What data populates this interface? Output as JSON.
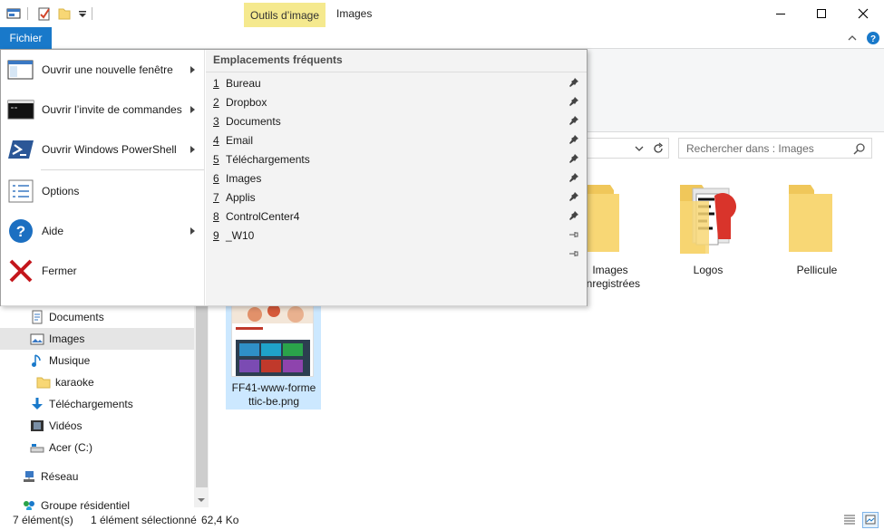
{
  "window": {
    "context_tab": "Outils d’image",
    "title": "Images"
  },
  "ribbon": {
    "file_tab": "Fichier"
  },
  "file_menu": {
    "items": [
      {
        "label": "Ouvrir une nouvelle fenêtre",
        "icon": "new-window-icon",
        "submenu": true
      },
      {
        "label": "Ouvrir l’invite de commandes",
        "icon": "command-prompt-icon",
        "submenu": true
      },
      {
        "label": "Ouvrir Windows PowerShell",
        "icon": "powershell-icon",
        "submenu": true
      },
      {
        "label": "Options",
        "icon": "options-icon",
        "submenu": false
      },
      {
        "label": "Aide",
        "icon": "help-icon",
        "submenu": true
      },
      {
        "label": "Fermer",
        "icon": "close-red-x-icon",
        "submenu": false
      }
    ],
    "frequent_title": "Emplacements fréquents",
    "frequent": [
      {
        "num": "1",
        "label": "Bureau",
        "pinned": true
      },
      {
        "num": "2",
        "label": "Dropbox",
        "pinned": true
      },
      {
        "num": "3",
        "label": "Documents",
        "pinned": true
      },
      {
        "num": "4",
        "label": "Email",
        "pinned": true
      },
      {
        "num": "5",
        "label": "Téléchargements",
        "pinned": true
      },
      {
        "num": "6",
        "label": "Images",
        "pinned": true
      },
      {
        "num": "7",
        "label": "Applis",
        "pinned": true
      },
      {
        "num": "8",
        "label": "ControlCenter4",
        "pinned": true
      },
      {
        "num": "9",
        "label": "_W10",
        "pinned": false
      },
      {
        "num": "",
        "label": "",
        "pinned": false
      }
    ]
  },
  "search": {
    "placeholder": "Rechercher dans : Images"
  },
  "nav": {
    "items": [
      {
        "label": "Documents",
        "icon": "documents-icon",
        "selected": false
      },
      {
        "label": "Images",
        "icon": "pictures-icon",
        "selected": true
      },
      {
        "label": "Musique",
        "icon": "music-icon",
        "selected": false
      },
      {
        "label": "karaoke",
        "icon": "folder-icon",
        "selected": false
      },
      {
        "label": "Téléchargements",
        "icon": "downloads-icon",
        "selected": false
      },
      {
        "label": "Vidéos",
        "icon": "videos-icon",
        "selected": false
      },
      {
        "label": "Acer (C:)",
        "icon": "drive-icon",
        "selected": false
      },
      {
        "label": "Réseau",
        "icon": "network-icon",
        "selected": false
      },
      {
        "label": "Groupe résidentiel",
        "icon": "homegroup-icon",
        "selected": false
      }
    ]
  },
  "content": {
    "folders": [
      {
        "label_line1": "Images",
        "label_line2": "enregistrées"
      },
      {
        "label_line1": "Logos",
        "label_line2": ""
      },
      {
        "label_line1": "Pellicule",
        "label_line2": ""
      }
    ],
    "file": {
      "name_line1": "FF41-www-forme",
      "name_line2": "ttic-be.png"
    }
  },
  "status": {
    "count": "7 élément(s)",
    "selection": "1 élément sélectionné",
    "size": "62,4 Ko"
  },
  "colors": {
    "accent": "#1979ca",
    "context_tab": "#f5e98e",
    "selection": "#cce8ff",
    "folder": "#f8d775"
  }
}
